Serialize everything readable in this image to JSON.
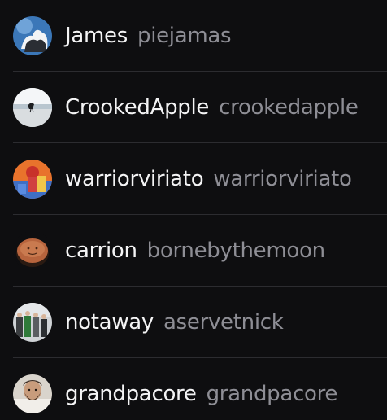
{
  "users": [
    {
      "display_name": "James",
      "handle": "piejamas",
      "avatar": "storm-cloud-avatar"
    },
    {
      "display_name": "CrookedApple",
      "handle": "crookedapple",
      "avatar": "bird-on-beach-avatar"
    },
    {
      "display_name": "warriorviriato",
      "handle": "warriorviriato",
      "avatar": "illustrated-warrior-avatar"
    },
    {
      "display_name": "carrion",
      "handle": "bornebythemoon",
      "avatar": "cookie-face-avatar"
    },
    {
      "display_name": "notaway",
      "handle": "aservetnick",
      "avatar": "street-group-avatar"
    },
    {
      "display_name": "grandpacore",
      "handle": "grandpacore",
      "avatar": "bearded-man-avatar"
    }
  ],
  "colors": {
    "background": "#0e0e10",
    "display_name": "#f4f4f5",
    "handle": "#8e8e95",
    "divider": "#2c2c30"
  }
}
